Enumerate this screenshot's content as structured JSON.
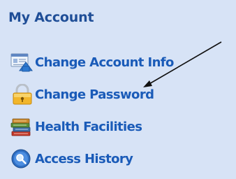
{
  "account_menu": {
    "title": "My Account",
    "items": [
      {
        "label": "Change Account Info",
        "icon": "account-info-icon"
      },
      {
        "label": "Change Password",
        "icon": "padlock-icon"
      },
      {
        "label": "Health Facilities",
        "icon": "books-stack-icon"
      },
      {
        "label": "Access History",
        "icon": "magnifier-icon"
      }
    ]
  },
  "colors": {
    "panel_background": "#d7e3f6",
    "title_text": "#1f4e97",
    "link_text": "#1a5bb8"
  }
}
